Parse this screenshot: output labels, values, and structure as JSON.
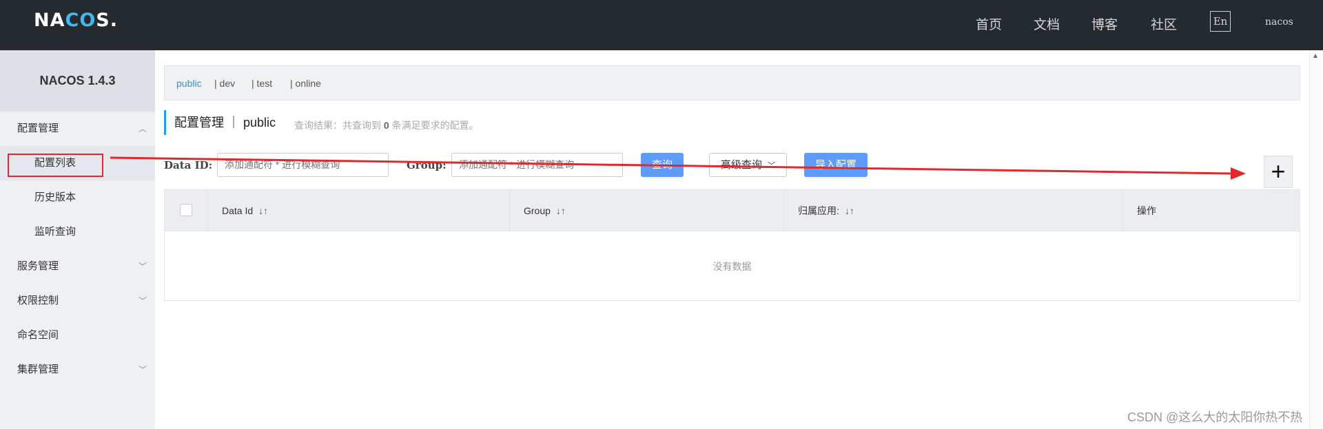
{
  "header": {
    "logo_text_1": "NA",
    "logo_text_accent": "CO",
    "logo_text_2": "S.",
    "nav": [
      "首页",
      "文档",
      "博客",
      "社区"
    ],
    "lang": "En",
    "user": "nacos"
  },
  "sidebar": {
    "title": "NACOS 1.4.3",
    "items": [
      {
        "label": "配置管理",
        "chevron": "^"
      },
      {
        "label": "配置列表"
      },
      {
        "label": "历史版本"
      },
      {
        "label": "监听查询"
      },
      {
        "label": "服务管理",
        "chevron": "v"
      },
      {
        "label": "权限控制",
        "chevron": "v"
      },
      {
        "label": "命名空间"
      },
      {
        "label": "集群管理",
        "chevron": "v"
      }
    ]
  },
  "namespaces": {
    "tabs": [
      "public",
      "| dev",
      "| test",
      "| online"
    ],
    "active": "public"
  },
  "page": {
    "title": "配置管理 ｜ public",
    "result_prefix": "查询结果：共查询到",
    "result_count": "0",
    "result_suffix": "条满足要求的配置。"
  },
  "filters": {
    "data_id_label": "Data ID:",
    "data_id_placeholder": "添加通配符 * 进行模糊查询",
    "group_label": "Group:",
    "group_placeholder": "添加通配符 * 进行模糊查询",
    "search_button": "查询",
    "advanced_button": "高级查询",
    "import_button": "导入配置"
  },
  "table": {
    "columns": [
      "Data Id",
      "Group",
      "归属应用:",
      "操作"
    ],
    "empty_text": "没有数据"
  },
  "add_button": "+",
  "watermark": "CSDN @这么大的太阳你热不热",
  "colors": {
    "topbar": "#252a2f",
    "accent": "#2b97d4",
    "primary_button": "#5d9cf9",
    "annotation_red": "#e0282e"
  }
}
